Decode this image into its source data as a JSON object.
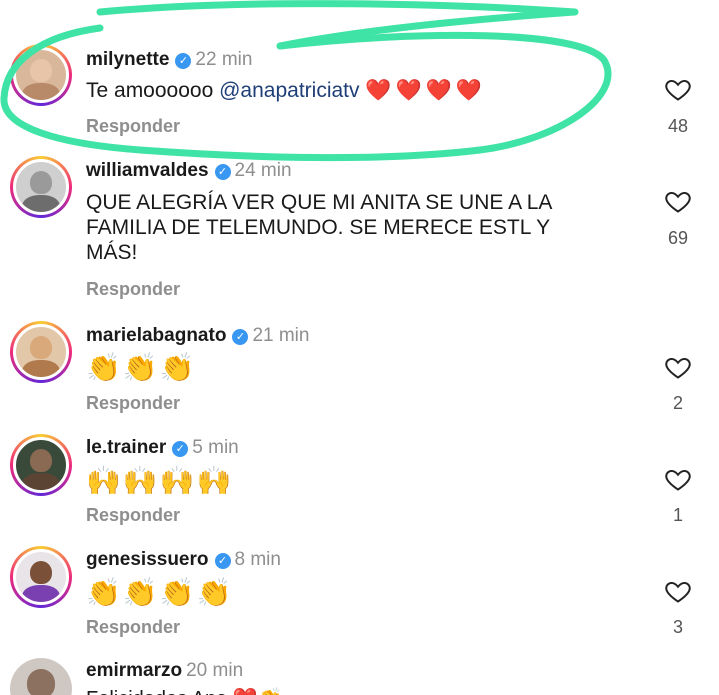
{
  "colors": {
    "highlight": "#3fe3a6",
    "verified": "#3897f0",
    "mention": "#1f3f78",
    "muted": "#8e8e8e"
  },
  "comments": [
    {
      "username": "milynette",
      "verified": true,
      "time": "22 min",
      "text_plain": "Te amoooooo",
      "mention": "@anapatriciatv",
      "hearts": "❤️❤️❤️❤️",
      "reply_label": "Responder",
      "likes": "48"
    },
    {
      "username": "williamvaldes",
      "verified": true,
      "time": "24 min",
      "text_line1": "QUE ALEGRÍA VER QUE MI ANITA SE UNE A LA",
      "text_line2": "FAMILIA DE TELEMUNDO. SE MERECE ESTL Y",
      "text_line3": "MÁS!",
      "reply_label": "Responder",
      "likes": "69"
    },
    {
      "username": "marielabagnato",
      "verified": true,
      "time": "21 min",
      "emojis": "👏👏👏",
      "reply_label": "Responder",
      "likes": "2"
    },
    {
      "username": "le.trainer",
      "verified": true,
      "time": "5 min",
      "emojis": "🙌🙌🙌🙌",
      "reply_label": "Responder",
      "likes": "1"
    },
    {
      "username": "genesissuero",
      "verified": true,
      "time": "8 min",
      "emojis": "👏👏👏👏",
      "reply_label": "Responder",
      "likes": "3"
    },
    {
      "username": "emirmarzo",
      "verified": false,
      "time": "20 min",
      "text_partial": "Felicidades Ana ❤️👏 ... "
    }
  ]
}
